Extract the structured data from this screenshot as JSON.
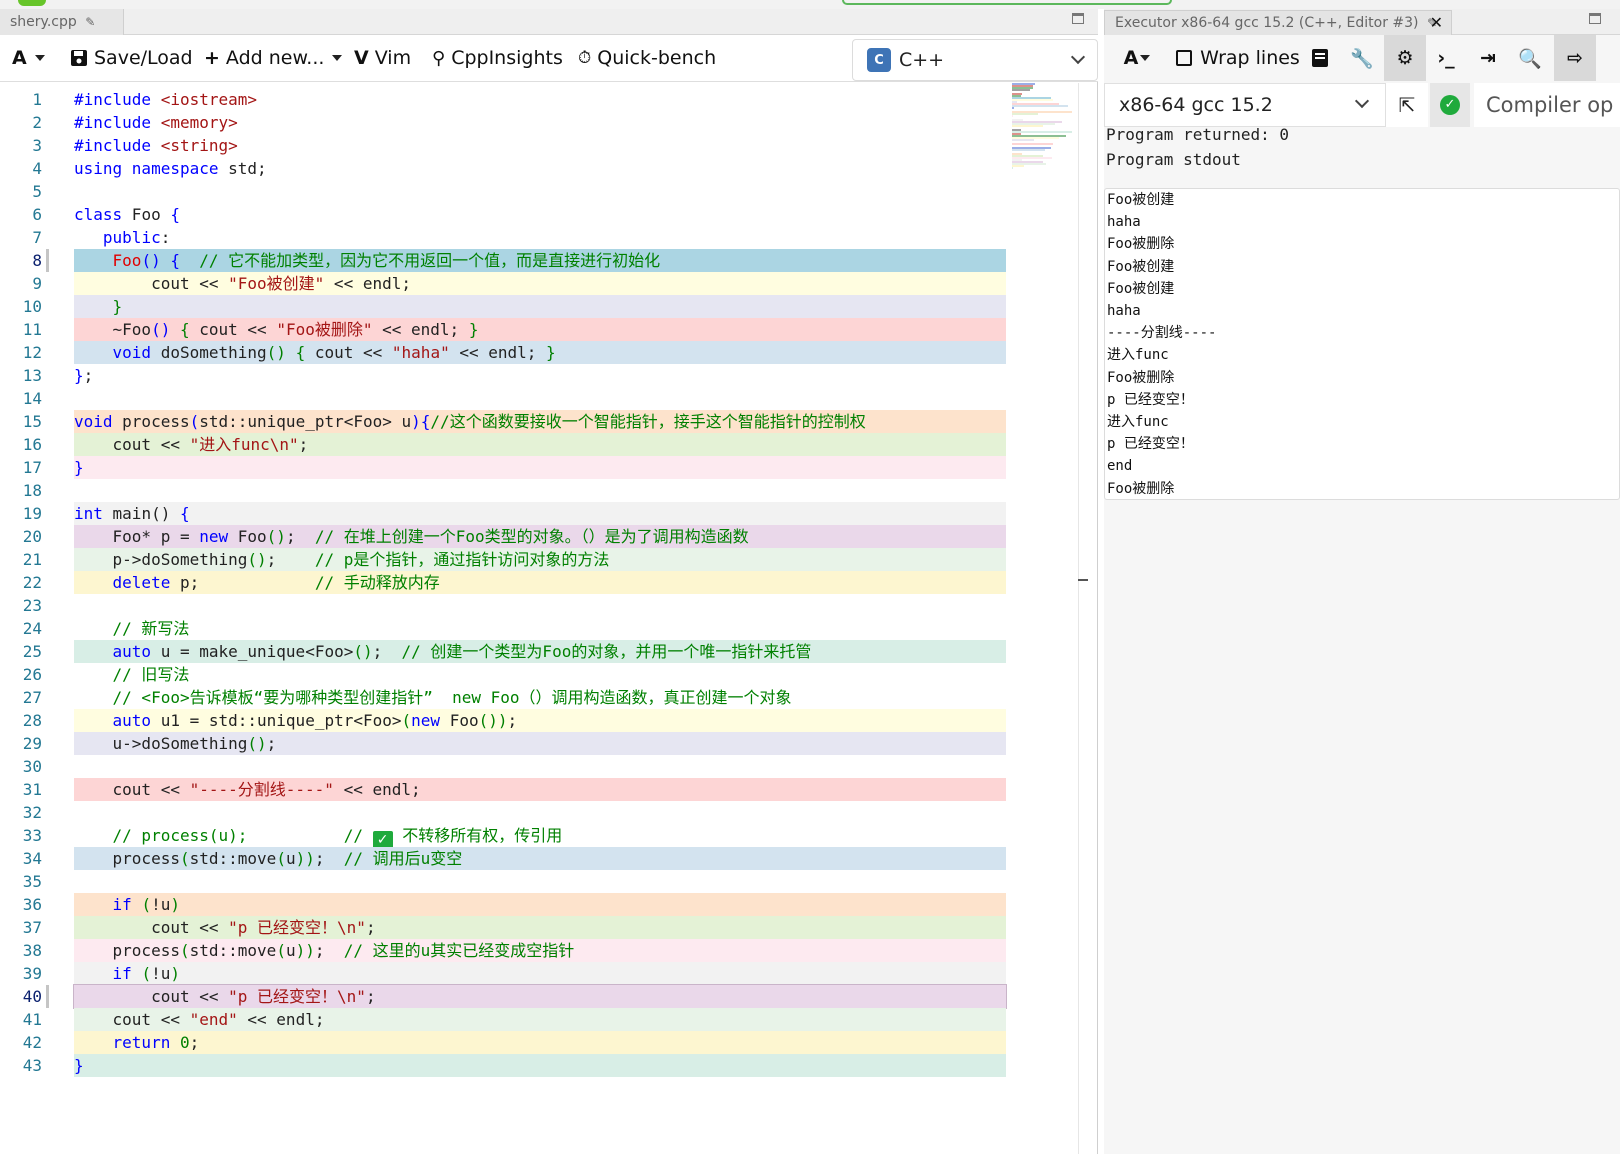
{
  "editor": {
    "tab_label": "shery.cpp",
    "toolbar": {
      "font_label": "A",
      "save_load": "Save/Load",
      "add_new": "Add new...",
      "vim": "Vim",
      "cppinsights": "CppInsights",
      "quickbench": "Quick-bench",
      "language": "C++"
    },
    "lines": [
      {
        "n": "1",
        "bg": "",
        "html": "<span class='pp'>#include</span> <span class='str'>&lt;iostream&gt;</span>"
      },
      {
        "n": "2",
        "bg": "",
        "html": "<span class='pp'>#include</span> <span class='str'>&lt;memory&gt;</span>"
      },
      {
        "n": "3",
        "bg": "",
        "html": "<span class='pp'>#include</span> <span class='str'>&lt;string&gt;</span>"
      },
      {
        "n": "4",
        "bg": "",
        "html": "<span class='kw'>using namespace</span> std;"
      },
      {
        "n": "5",
        "bg": "",
        "html": ""
      },
      {
        "n": "6",
        "bg": "",
        "html": "<span class='kw'>class</span> Foo <span class='kw'>{</span>"
      },
      {
        "n": "7",
        "bg": "",
        "html": "   <span class='kw'>public</span>:"
      },
      {
        "n": "8",
        "bg": "#abd5e3",
        "active": true,
        "html": "    <span class='fn-err'>Foo</span><span class='kw'>()</span> <span class='kw'>{</span>  <span class='cm'>// 它不能加类型，因为它不用返回一个值，而是直接进行初始化</span>"
      },
      {
        "n": "9",
        "bg": "#fffde0",
        "html": "        cout &lt;&lt; <span class='str'>\"Foo被创建\"</span> &lt;&lt; endl;"
      },
      {
        "n": "10",
        "bg": "#e6e6f2",
        "html": "    <span class='cm'>}</span>"
      },
      {
        "n": "11",
        "bg": "#fdd5d5",
        "html": "    ~Foo<span class='kw'>()</span> <span class='cm'>{</span> cout &lt;&lt; <span class='str'>\"Foo被删除\"</span> &lt;&lt; endl; <span class='cm'>}</span>"
      },
      {
        "n": "12",
        "bg": "#d3e3ef",
        "html": "    <span class='kw'>void</span> doSomething<span class='cm'>()</span> <span class='cm'>{</span> cout &lt;&lt; <span class='str'>\"haha\"</span> &lt;&lt; endl; <span class='cm'>}</span>"
      },
      {
        "n": "13",
        "bg": "",
        "html": "<span class='kw'>}</span>;"
      },
      {
        "n": "14",
        "bg": "",
        "html": ""
      },
      {
        "n": "15",
        "bg": "#fde3cc",
        "html": "<span class='kw'>void</span> process<span class='kw'>(</span>std::unique_ptr&lt;Foo&gt; u<span class='kw'>){</span><span class='cm'>//这个函数要接收一个智能指针，接手这个智能指针的控制权</span>"
      },
      {
        "n": "16",
        "bg": "#e4f2d6",
        "html": "    cout &lt;&lt; <span class='str'>\"进入func\\n\"</span>;"
      },
      {
        "n": "17",
        "bg": "#fdeaf0",
        "html": "<span class='kw'>}</span>"
      },
      {
        "n": "18",
        "bg": "",
        "html": ""
      },
      {
        "n": "19",
        "bg": "#f2f2f2",
        "html": "<span class='kw'>int</span> main() <span class='kw'>{</span>"
      },
      {
        "n": "20",
        "bg": "#ead8ea",
        "html": "    Foo* p = <span class='kw'>new</span> Foo<span class='cm'>()</span>;  <span class='cm'>// 在堆上创建一个Foo类型的对象。（）是为了调用构造函数</span>"
      },
      {
        "n": "21",
        "bg": "#e8f3e8",
        "html": "    p-&gt;doSomething<span class='cm'>()</span>;    <span class='cm'>// p是个指针，通过指针访问对象的方法</span>"
      },
      {
        "n": "22",
        "bg": "#fdf6d0",
        "html": "    <span class='kw'>delete</span> p;            <span class='cm'>// 手动释放内存</span>"
      },
      {
        "n": "23",
        "bg": "",
        "html": ""
      },
      {
        "n": "24",
        "bg": "",
        "html": "    <span class='cm'>// 新写法</span>"
      },
      {
        "n": "25",
        "bg": "#d8eee6",
        "html": "    <span class='kw'>auto</span> u = make_unique&lt;Foo&gt;<span class='cm'>()</span>;  <span class='cm'>// 创建一个类型为Foo的对象，并用一个唯一指针来托管</span>"
      },
      {
        "n": "26",
        "bg": "",
        "html": "    <span class='cm'>// 旧写法</span>"
      },
      {
        "n": "27",
        "bg": "",
        "html": "    <span class='cm'>// &lt;Foo&gt;告诉模板“要为哪种类型创建指针”  new Foo（）调用构造函数，真正创建一个对象</span>"
      },
      {
        "n": "28",
        "bg": "#fffde0",
        "html": "    <span class='kw'>auto</span> u1 = std::unique_ptr&lt;Foo&gt;<span class='cm'>(</span><span class='kw'>new</span> Foo<span class='cm'>())</span>;"
      },
      {
        "n": "29",
        "bg": "#e6e6f2",
        "html": "    u-&gt;doSomething<span class='cm'>()</span>;"
      },
      {
        "n": "30",
        "bg": "",
        "html": ""
      },
      {
        "n": "31",
        "bg": "#fdd5d5",
        "html": "    cout &lt;&lt; <span class='str'>\"----分割线----\"</span> &lt;&lt; endl;"
      },
      {
        "n": "32",
        "bg": "",
        "html": ""
      },
      {
        "n": "33",
        "bg": "",
        "html": "    <span class='cm'>// process(u);          //</span> <span class='checkmark'>✓</span> <span class='cm'>不转移所有权，传引用</span>"
      },
      {
        "n": "34",
        "bg": "#d3e3ef",
        "html": "    process<span class='cm'>(</span>std::move<span class='cm'>(</span>u<span class='cm'>))</span>;  <span class='cm'>// 调用后u变空</span>"
      },
      {
        "n": "35",
        "bg": "",
        "html": ""
      },
      {
        "n": "36",
        "bg": "#fde3cc",
        "html": "    <span class='kw'>if</span> <span class='cm'>(</span>!u<span class='cm'>)</span>"
      },
      {
        "n": "37",
        "bg": "#e4f2d6",
        "html": "        cout &lt;&lt; <span class='str'>\"p 已经变空！\\n\"</span>;"
      },
      {
        "n": "38",
        "bg": "#fdeaf0",
        "html": "    process<span class='cm'>(</span>std::move<span class='cm'>(</span>u<span class='cm'>))</span>;  <span class='cm'>// 这里的u其实已经变成空指针</span>"
      },
      {
        "n": "39",
        "bg": "#f2f2f2",
        "html": "    <span class='kw'>if</span> <span class='cm'>(</span>!u<span class='cm'>)</span>"
      },
      {
        "n": "40",
        "bg": "#ead8ea",
        "active": true,
        "html": "        cout &lt;&lt; <span class='str'>\"p 已经变空！\\n\"</span>;"
      },
      {
        "n": "41",
        "bg": "#e8f3e8",
        "html": "    cout &lt;&lt; <span class='str'>\"end\"</span> &lt;&lt; endl;"
      },
      {
        "n": "42",
        "bg": "#fdf6d0",
        "html": "    <span class='kw'>return</span> <span class='cm'>0</span>;"
      },
      {
        "n": "43",
        "bg": "#d8eee6",
        "html": "<span class='kw'>}</span>"
      }
    ]
  },
  "executor": {
    "tab_label": "Executor x86-64 gcc 15.2 (C++, Editor #3)",
    "toolbar": {
      "font_label": "A",
      "wrap_lines": "Wrap lines"
    },
    "compiler": "x86-64 gcc 15.2",
    "compiler_options": "Compiler op",
    "program_returned": "Program returned: 0",
    "program_stdout": "Program stdout",
    "stdout_lines": [
      "Foo被创建",
      "haha",
      "Foo被删除",
      "Foo被创建",
      "Foo被创建",
      "haha",
      "----分割线----",
      "进入func",
      "Foo被删除",
      "p 已经变空！",
      "进入func",
      "p 已经变空！",
      "end",
      "Foo被删除"
    ]
  }
}
